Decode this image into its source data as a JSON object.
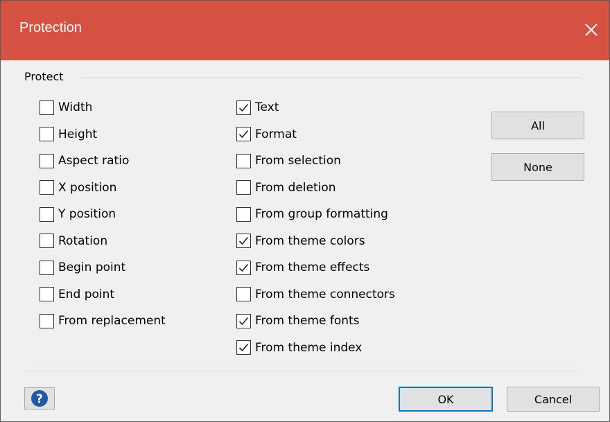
{
  "window": {
    "title": "Protection"
  },
  "group": {
    "label": "Protect"
  },
  "column1": [
    {
      "label": "Width",
      "checked": false
    },
    {
      "label": "Height",
      "checked": false
    },
    {
      "label": "Aspect ratio",
      "checked": false
    },
    {
      "label": "X position",
      "checked": false
    },
    {
      "label": "Y position",
      "checked": false
    },
    {
      "label": "Rotation",
      "checked": false
    },
    {
      "label": "Begin point",
      "checked": false
    },
    {
      "label": "End point",
      "checked": false
    },
    {
      "label": "From replacement",
      "checked": false
    }
  ],
  "column2": [
    {
      "label": "Text",
      "checked": true
    },
    {
      "label": "Format",
      "checked": true
    },
    {
      "label": "From selection",
      "checked": false
    },
    {
      "label": "From deletion",
      "checked": false
    },
    {
      "label": "From group formatting",
      "checked": false
    },
    {
      "label": "From theme colors",
      "checked": true
    },
    {
      "label": "From theme effects",
      "checked": true
    },
    {
      "label": "From theme connectors",
      "checked": false
    },
    {
      "label": "From theme fonts",
      "checked": true
    },
    {
      "label": "From theme index",
      "checked": true
    }
  ],
  "buttons": {
    "all": "All",
    "none": "None",
    "ok": "OK",
    "cancel": "Cancel"
  },
  "icons": {
    "close": "close-icon",
    "help": "help-icon"
  },
  "colors": {
    "titlebar": "#d55142",
    "help_icon": "#1f5aa6",
    "default_button_border": "#0078d7"
  }
}
